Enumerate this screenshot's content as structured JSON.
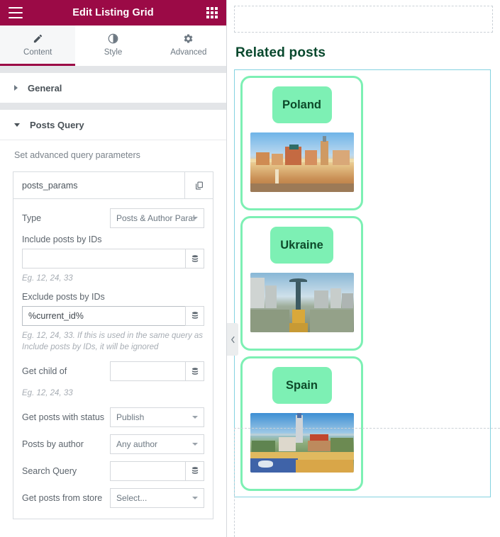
{
  "panel": {
    "header": {
      "title": "Edit Listing Grid",
      "menu_icon": "hamburger-icon",
      "apps_icon": "grid-apps-icon"
    },
    "tabs": [
      {
        "label": "Content",
        "icon": "pencil-icon",
        "active": true
      },
      {
        "label": "Style",
        "icon": "contrast-circle-icon",
        "active": false
      },
      {
        "label": "Advanced",
        "icon": "gear-icon",
        "active": false
      }
    ],
    "sections": [
      {
        "label": "General",
        "expanded": false
      },
      {
        "label": "Posts Query",
        "expanded": true
      }
    ],
    "posts_query": {
      "description": "Set advanced query parameters",
      "repeater": {
        "item_title": "posts_params",
        "duplicate_icon": "copy-icon",
        "fields": {
          "type_label": "Type",
          "type_value": "Posts & Author Paral",
          "include_label": "Include posts by IDs",
          "include_value": "",
          "include_placeholder": "",
          "include_hint": "Eg. 12, 24, 33",
          "exclude_label": "Exclude posts by IDs",
          "exclude_value": "%current_id%",
          "exclude_hint": "Eg. 12, 24, 33. If this is used in the same query as Include posts by IDs, it will be ignored",
          "child_label": "Get child of",
          "child_value": "",
          "child_hint": "Eg. 12, 24, 33",
          "status_label": "Get posts with status",
          "status_value": "Publish",
          "author_label": "Posts by author",
          "author_value": "Any author",
          "search_label": "Search Query",
          "search_value": "",
          "store_label": "Get posts from store",
          "store_value": "Select...",
          "dynamic_tag_icon": "database-icon"
        }
      }
    }
  },
  "preview": {
    "heading": "Related posts",
    "collapse_icon": "chevron-left-icon",
    "cards": [
      {
        "title": "Poland",
        "photo": "warsaw-old-town-photo"
      },
      {
        "title": "Ukraine",
        "photo": "kyiv-independence-monument-photo"
      },
      {
        "title": "Spain",
        "photo": "barcelona-park-guell-photo"
      }
    ]
  },
  "colors": {
    "header_maroon": "#9b0a46",
    "badge_green": "#7df0b4",
    "card_border_green": "#7df0b4",
    "heading_green": "#08482d",
    "grid_outline_blue": "#84d2e0",
    "dashed_gray": "#cbd1d7"
  }
}
